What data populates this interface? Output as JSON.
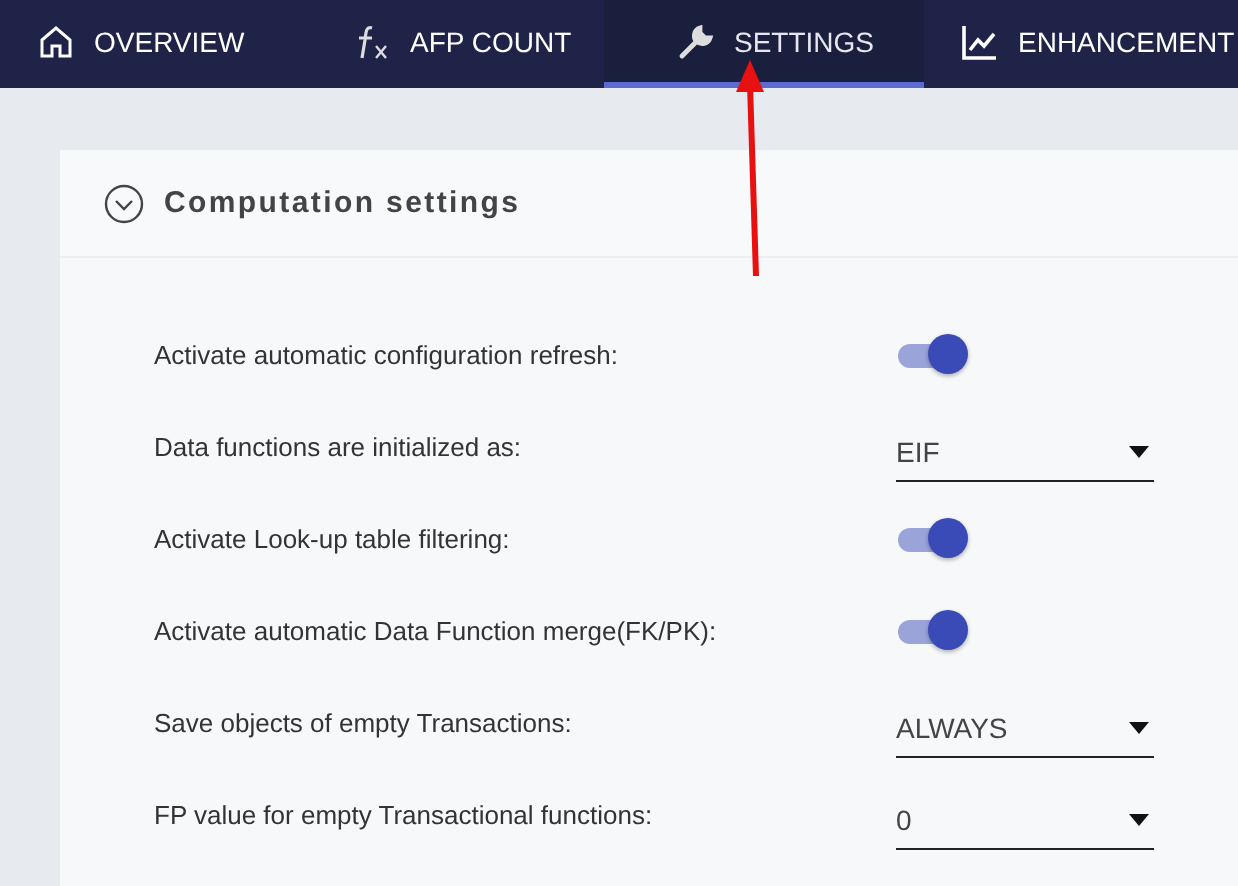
{
  "tabs": [
    {
      "label": "OVERVIEW",
      "kind": "home",
      "selected": false
    },
    {
      "label": "AFP COUNT",
      "kind": "function",
      "selected": false
    },
    {
      "label": "SETTINGS",
      "kind": "wrench",
      "selected": true
    },
    {
      "label": "ENHANCEMENT",
      "kind": "chart",
      "selected": false
    }
  ],
  "section": {
    "title": "Computation settings",
    "expanded": true
  },
  "settings": [
    {
      "kind": "toggle",
      "label": "Activate automatic configuration refresh:",
      "on": true
    },
    {
      "kind": "select",
      "label": "Data functions are initialized as:",
      "value": "EIF"
    },
    {
      "kind": "toggle",
      "label": "Activate Look-up table filtering:",
      "on": true
    },
    {
      "kind": "toggle",
      "label": "Activate automatic Data Function merge(FK/PK):",
      "on": true
    },
    {
      "kind": "select",
      "label": "Save objects of empty Transactions:",
      "value": "ALWAYS"
    },
    {
      "kind": "select",
      "label": "FP value for empty Transactional functions:",
      "value": "0"
    }
  ]
}
